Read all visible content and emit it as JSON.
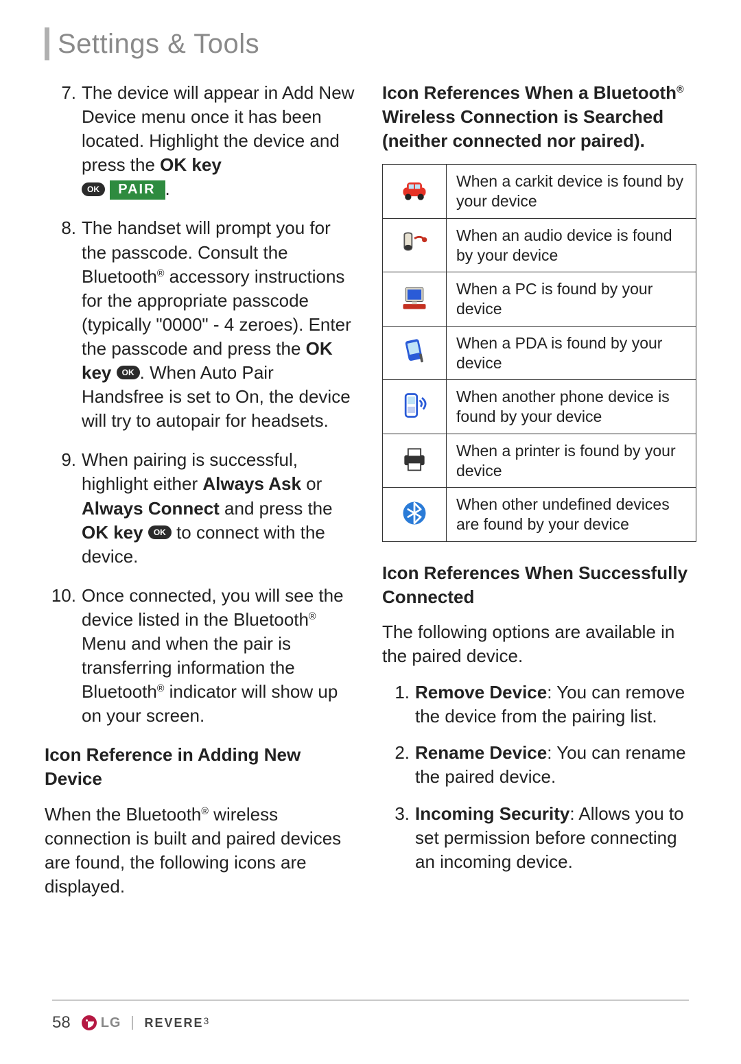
{
  "title": "Settings & Tools",
  "left": {
    "steps": [
      {
        "n": "7.",
        "pre": "The device will appear in Add New Device menu once it has been located. Highlight the device and press the ",
        "bold1": "OK key",
        "ok": "OK",
        "pair": "PAIR",
        "post": "."
      },
      {
        "n": "8.",
        "pre": "The handset will prompt you for the passcode. Consult the Bluetooth",
        "reg": "®",
        "mid": " accessory instructions for the appropriate passcode (typically \"0000\" - 4 zeroes). Enter the passcode and press the ",
        "bold1": "OK key",
        "ok": "OK",
        "post": ". When Auto Pair Handsfree is set to On, the device will try to autopair for headsets."
      },
      {
        "n": "9.",
        "pre": "When pairing is successful, highlight either ",
        "bold1": "Always Ask",
        "mid1": " or ",
        "bold2": "Always Connect",
        "mid2": " and press the ",
        "bold3": "OK key",
        "ok": "OK",
        "post": " to connect with the device."
      },
      {
        "n": "10.",
        "pre": "Once connected, you will see the device listed in the Bluetooth",
        "reg": "®",
        "mid": " Menu and when the pair is transferring information the Bluetooth",
        "reg2": "®",
        "post": " indicator will show up on your screen."
      }
    ],
    "subhead": "Icon Reference in Adding New Device",
    "para_pre": "When the Bluetooth",
    "para_reg": "®",
    "para_post": " wireless connection is built and paired devices are found, the following icons are displayed."
  },
  "right": {
    "subhead1_l1": "Icon References When a Bluetooth",
    "subhead1_reg": "®",
    "subhead1_l2": " Wireless Connection is Searched",
    "subhead1_l3": "(neither connected nor paired).",
    "icon_table": [
      {
        "icon": "car",
        "desc": "When a carkit device is found by your device"
      },
      {
        "icon": "audio",
        "desc": "When an audio device is found by your device"
      },
      {
        "icon": "pc",
        "desc": "When a PC is found by your device"
      },
      {
        "icon": "pda",
        "desc": "When a PDA is found by your device"
      },
      {
        "icon": "phone",
        "desc": "When another phone device is found by your device"
      },
      {
        "icon": "printer",
        "desc": "When a printer is found by your device"
      },
      {
        "icon": "bluetooth",
        "desc": "When other undefined devices are found by your device"
      }
    ],
    "subhead2": "Icon References When Successfully Connected",
    "para2": "The following options are available in the paired device.",
    "options": [
      {
        "n": "1.",
        "bold": "Remove Device",
        "rest": ": You can remove the device from the pairing list."
      },
      {
        "n": "2.",
        "bold": "Rename Device",
        "rest": ": You can rename the paired device."
      },
      {
        "n": "3.",
        "bold": "Incoming Security",
        "rest": ": Allows you to set permission before connecting an incoming device."
      }
    ]
  },
  "footer": {
    "page": "58",
    "brand": "LG",
    "model": "REVERE",
    "model_suffix": "3"
  }
}
